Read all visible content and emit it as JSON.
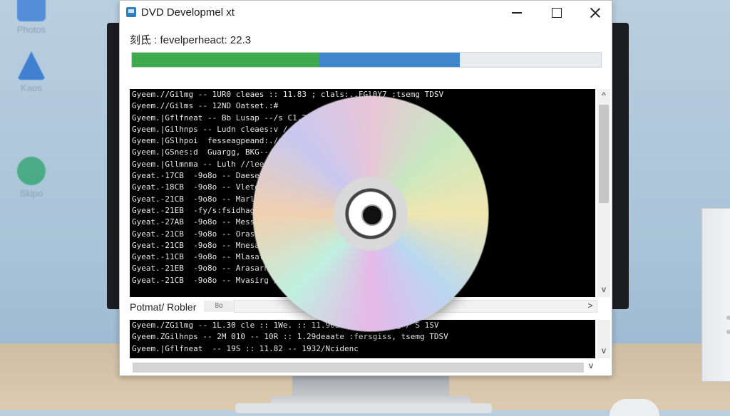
{
  "desktop": {
    "icons": [
      {
        "label": "Photos",
        "icon": "photos-icon",
        "color": "#3b7dd8"
      },
      {
        "label": "Kaos",
        "icon": "app-a-icon",
        "color": "#2b72cf"
      },
      {
        "label": "Skipo",
        "icon": "globe-icon",
        "color": "#2aa36b"
      }
    ]
  },
  "window": {
    "title": "DVD Developmel xt",
    "status": "刻氐 :  fevelperheact: 22.3",
    "progress": {
      "green_fraction": 0.4,
      "blue_fraction": 0.3,
      "green_color": "#3daa4d",
      "blue_color": "#3f87c8"
    },
    "console_lines": [
      "Gyeem.//Gilmg -- 1UR0 cleaes :: 11.83 ; clals:..FGl0Y7 :tsemg TDSV",
      "Gyeem.//Gilms -- 12ND Oatset.:#",
      "Gyeem.|Gflfneat -- Bb Lusap --/s C1.23",
      "Gyeem.|Gilhnps -- Ludn cleaes:v / Ide",
      "Gyeem.|GSlhpoi  fesseagpeand:./dle",
      "Gyeem.|GSnes:d  Guargg, BKG--/s dle",
      "Gyeem.|Gllmnma -- Lulh //lee",
      "Gyeat.-17CB  -9o8o -- Daeserm /s",
      "Gyeat.-18CB  -9o8o -- Vleteng /s",
      "Gyeat.-21CB  -9o8o -- Marlagus /s",
      "Gyeat.-21EB  -fy/s:fsidhagsg /s",
      "Gyeat.-27AB  -9o8o -- Messngg /s",
      "Gyeat.-21CB  -9o8o -- Orassetg /s",
      "Gyeat.-21CB  -9o8o -- Mnesatn /s",
      "Gyeat.-11CB  -9o8o -- Mlasater /s",
      "Gyeat.-21EB  -9o8o -- Arasarn /s",
      "Gyeat.-21CB  -9o8o -- Mvasirg /s/s"
    ],
    "section_label": "Potmat/ Robler",
    "section_chip": "8o",
    "console2_lines": [
      "Gyeem./ZGilmg -- 1L.30 cle :: 1We. :: 11.90deaate :fenedg / S 1SV",
      "Gyeem.ZGilhnps -- 2M 010 -- 10R :: 1.29deaate :fersgiss, tsemg TDSV",
      "Gyeem.|Gflfneat  -- 19S :: 11.82 -- 1932/Ncidenc"
    ],
    "scroll_up": "^",
    "scroll_down": "v",
    "scroll_right": ">"
  }
}
